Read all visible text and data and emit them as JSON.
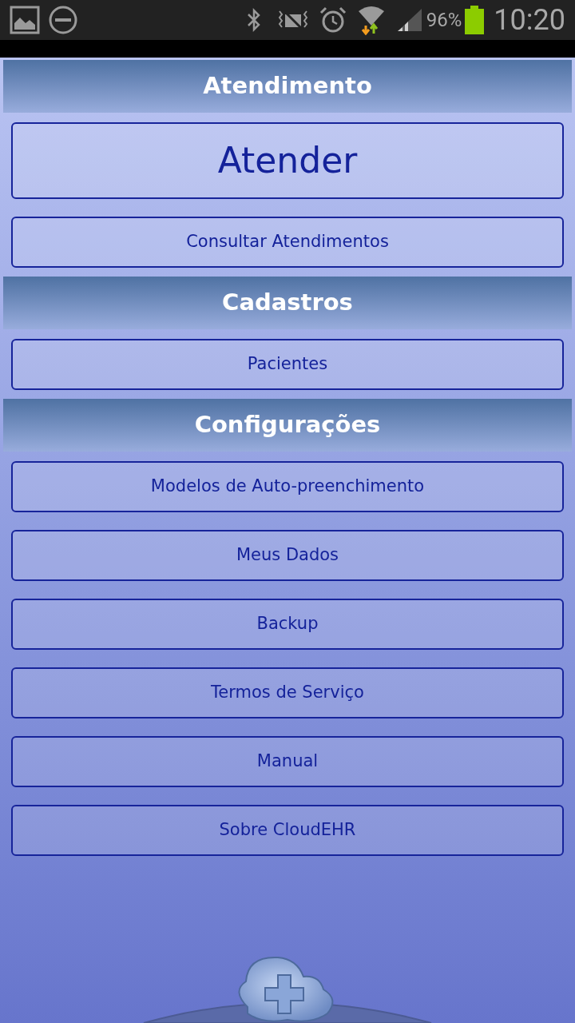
{
  "status_bar": {
    "battery": "96%",
    "time": "10:20"
  },
  "sections": [
    {
      "title": "Atendimento",
      "items": [
        {
          "label": "Atender",
          "kind": "large"
        },
        {
          "label": "Consultar Atendimentos",
          "kind": "normal"
        }
      ]
    },
    {
      "title": "Cadastros",
      "items": [
        {
          "label": "Pacientes",
          "kind": "normal"
        }
      ]
    },
    {
      "title": "Configurações",
      "items": [
        {
          "label": "Modelos de Auto-preenchimento",
          "kind": "normal"
        },
        {
          "label": "Meus Dados",
          "kind": "normal"
        },
        {
          "label": "Backup",
          "kind": "normal"
        },
        {
          "label": "Termos de Serviço",
          "kind": "normal"
        },
        {
          "label": "Manual",
          "kind": "normal"
        },
        {
          "label": "Sobre CloudEHR",
          "kind": "normal"
        }
      ]
    }
  ]
}
